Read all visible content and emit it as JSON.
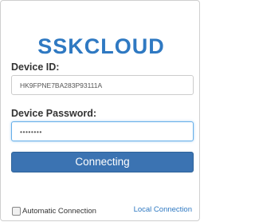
{
  "app": {
    "title": "SSKCLOUD"
  },
  "form": {
    "device_id_label": "Device ID:",
    "device_id_value": "HK9FPNE7BA283P93111A",
    "device_password_label": "Device Password:",
    "device_password_value": "••••••••",
    "connect_button_label": "Connecting",
    "automatic_connection_label": "Automatic Connection",
    "automatic_connection_checked": false,
    "local_connection_label": "Local Connection"
  },
  "colors": {
    "brand": "#2f79c2",
    "button": "#3b73b2",
    "focus_border": "#66afe9"
  }
}
